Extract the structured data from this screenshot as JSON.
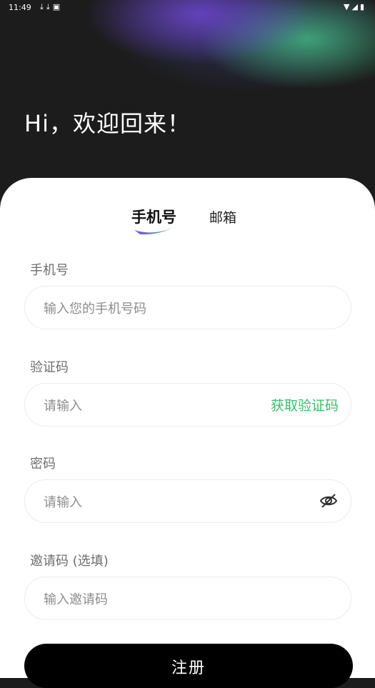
{
  "status_bar": {
    "time": "11:49",
    "left_icons": [
      "download-icon",
      "download-icon",
      "notification-icon"
    ],
    "right_icons": [
      "wifi-icon",
      "signal-icon",
      "battery-icon"
    ]
  },
  "header": {
    "welcome": "Hi，欢迎回来！"
  },
  "tabs": [
    {
      "label": "手机号",
      "active": true
    },
    {
      "label": "邮箱",
      "active": false
    }
  ],
  "form": {
    "phone": {
      "label": "手机号",
      "placeholder": "输入您的手机号码"
    },
    "code": {
      "label": "验证码",
      "placeholder": "请输入",
      "action": "获取验证码"
    },
    "password": {
      "label": "密码",
      "placeholder": "请输入"
    },
    "invite": {
      "label": "邀请码 (选填)",
      "placeholder": "输入邀请码"
    }
  },
  "submit": {
    "label": "注册"
  },
  "colors": {
    "accent_green": "#36c16a",
    "tab_underline_purple": "#7b4fe0",
    "tab_underline_green": "#46c47a"
  }
}
